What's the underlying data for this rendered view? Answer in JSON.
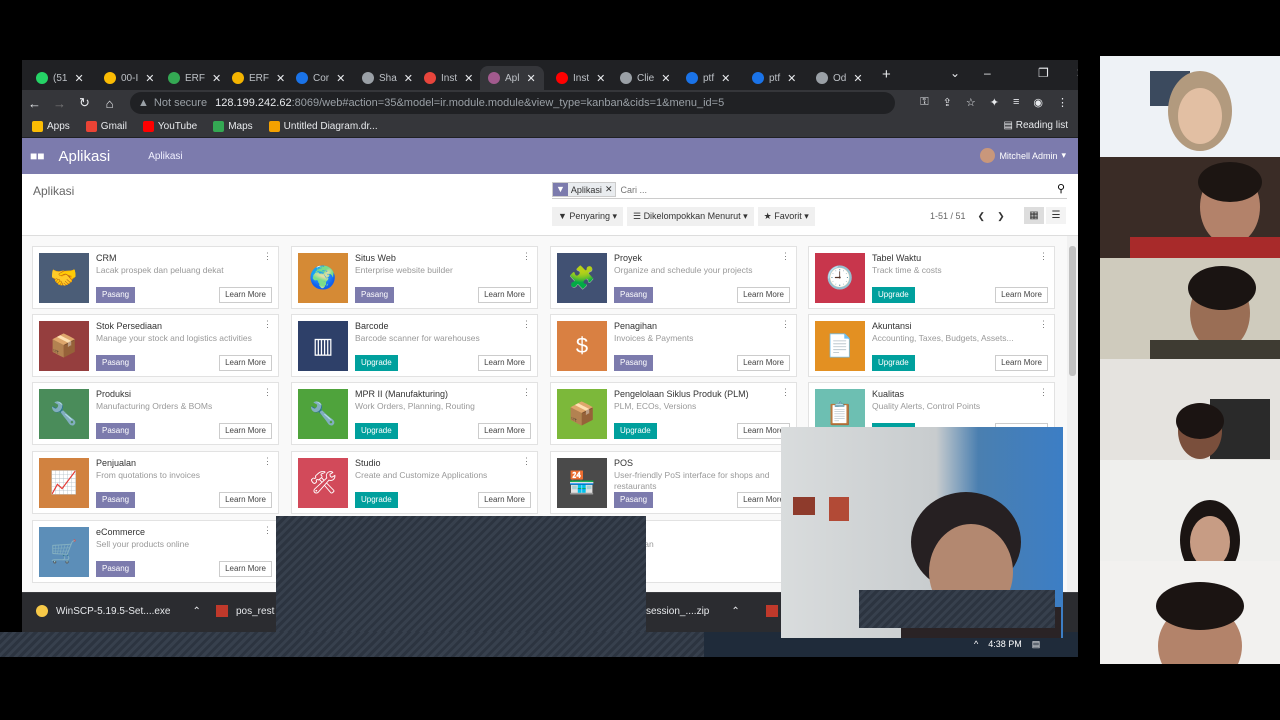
{
  "tabs": [
    {
      "label": "(51",
      "color": "#25d366"
    },
    {
      "label": "00-I",
      "color": "#fbbc04"
    },
    {
      "label": "ERF",
      "color": "#34a853"
    },
    {
      "label": "ERF",
      "color": "#f4b400"
    },
    {
      "label": "Cor",
      "color": "#1a73e8"
    },
    {
      "label": "Sha",
      "color": "#9aa0a6"
    },
    {
      "label": "Inst",
      "color": "#e8453c"
    },
    {
      "label": "Apl",
      "color": "#a25a8e"
    },
    {
      "label": "Inst",
      "color": "#ff0000"
    },
    {
      "label": "Clie",
      "color": "#9aa0a6"
    },
    {
      "label": "ptf",
      "color": "#1a73e8"
    },
    {
      "label": "ptf",
      "color": "#1a73e8"
    },
    {
      "label": "Od",
      "color": "#9aa0a6"
    }
  ],
  "address": {
    "security": "Not secure",
    "host": "128.199.242.62",
    "path": ":8069/web#action=35&model=ir.module.module&view_type=kanban&cids=1&menu_id=5"
  },
  "bookmarks": [
    {
      "label": "Apps",
      "color": "#fbbc04"
    },
    {
      "label": "Gmail",
      "color": "#ea4335"
    },
    {
      "label": "YouTube",
      "color": "#ff0000"
    },
    {
      "label": "Maps",
      "color": "#34a853"
    },
    {
      "label": "Untitled Diagram.dr...",
      "color": "#f4a100"
    }
  ],
  "reading_list": "Reading list",
  "odoo": {
    "brand": "Aplikasi",
    "menu": "Aplikasi",
    "user": "Mitchell Admin",
    "breadcrumb": "Aplikasi",
    "facet": "Aplikasi",
    "search_placeholder": "Cari ...",
    "filter": "Penyaring",
    "groupby": "Dikelompokkan Menurut",
    "favorite": "Favorit",
    "pager": "1-51 / 51"
  },
  "apps": [
    {
      "name": "CRM",
      "desc": "Lacak prospek dan peluang dekat",
      "action": "Pasang",
      "color": "#4b5d77",
      "glyph": "🤝"
    },
    {
      "name": "Situs Web",
      "desc": "Enterprise website builder",
      "action": "Pasang",
      "color": "#d58a35",
      "glyph": "🌍"
    },
    {
      "name": "Proyek",
      "desc": "Organize and schedule your projects",
      "action": "Pasang",
      "color": "#415173",
      "glyph": "🧩"
    },
    {
      "name": "Tabel Waktu",
      "desc": "Track time & costs",
      "action": "Upgrade",
      "color": "#c8364c",
      "glyph": "🕘"
    },
    {
      "name": "Stok Persediaan",
      "desc": "Manage your stock and logistics activities",
      "action": "Pasang",
      "color": "#953e3e",
      "glyph": "📦"
    },
    {
      "name": "Barcode",
      "desc": "Barcode scanner for warehouses",
      "action": "Upgrade",
      "color": "#2e4069",
      "glyph": "▥"
    },
    {
      "name": "Penagihan",
      "desc": "Invoices & Payments",
      "action": "Pasang",
      "color": "#d98042",
      "glyph": "$"
    },
    {
      "name": "Akuntansi",
      "desc": "Accounting, Taxes, Budgets, Assets...",
      "action": "Upgrade",
      "color": "#e39022",
      "glyph": "📄"
    },
    {
      "name": "Produksi",
      "desc": "Manufacturing Orders & BOMs",
      "action": "Pasang",
      "color": "#4a8c5a",
      "glyph": "🔧"
    },
    {
      "name": "MPR II (Manufakturing)",
      "desc": "Work Orders, Planning, Routing",
      "action": "Upgrade",
      "color": "#4fa33c",
      "glyph": "🔧"
    },
    {
      "name": "Pengelolaan Siklus Produk (PLM)",
      "desc": "PLM, ECOs, Versions",
      "action": "Upgrade",
      "color": "#7cb83a",
      "glyph": "📦"
    },
    {
      "name": "Kualitas",
      "desc": "Quality Alerts, Control Points",
      "action": "Upgrade",
      "color": "#6dbfb2",
      "glyph": "📋"
    },
    {
      "name": "Penjualan",
      "desc": "From quotations to invoices",
      "action": "Pasang",
      "color": "#d18240",
      "glyph": "📈"
    },
    {
      "name": "Studio",
      "desc": "Create and Customize Applications",
      "action": "Upgrade",
      "color": "#d24a5a",
      "glyph": "🛠"
    },
    {
      "name": "POS",
      "desc": "User-friendly PoS interface for shops and restaurants",
      "action": "Pasang",
      "color": "#4a4a4a",
      "glyph": "🏪"
    },
    {
      "name": "",
      "desc": "",
      "action": "",
      "color": "#ffffff",
      "glyph": ""
    },
    {
      "name": "eCommerce",
      "desc": "Sell your products online",
      "action": "Pasang",
      "color": "#5c8eb8",
      "glyph": "🛒"
    },
    {
      "name": "",
      "desc": "",
      "action": "",
      "color": "#ffffff",
      "glyph": ""
    },
    {
      "name": "k",
      "desc": "el bantuan",
      "action": "",
      "color": "#ffffff",
      "glyph": ""
    },
    {
      "name": "",
      "desc": "",
      "action": "",
      "color": "#ffffff",
      "glyph": ""
    }
  ],
  "learn_more": "Learn More",
  "downloads": [
    {
      "name": "WinSCP-5.19.5-Set....exe"
    },
    {
      "name": "pos_rest"
    },
    {
      "name": "session_....zip"
    }
  ],
  "clock": "4:38 PM"
}
